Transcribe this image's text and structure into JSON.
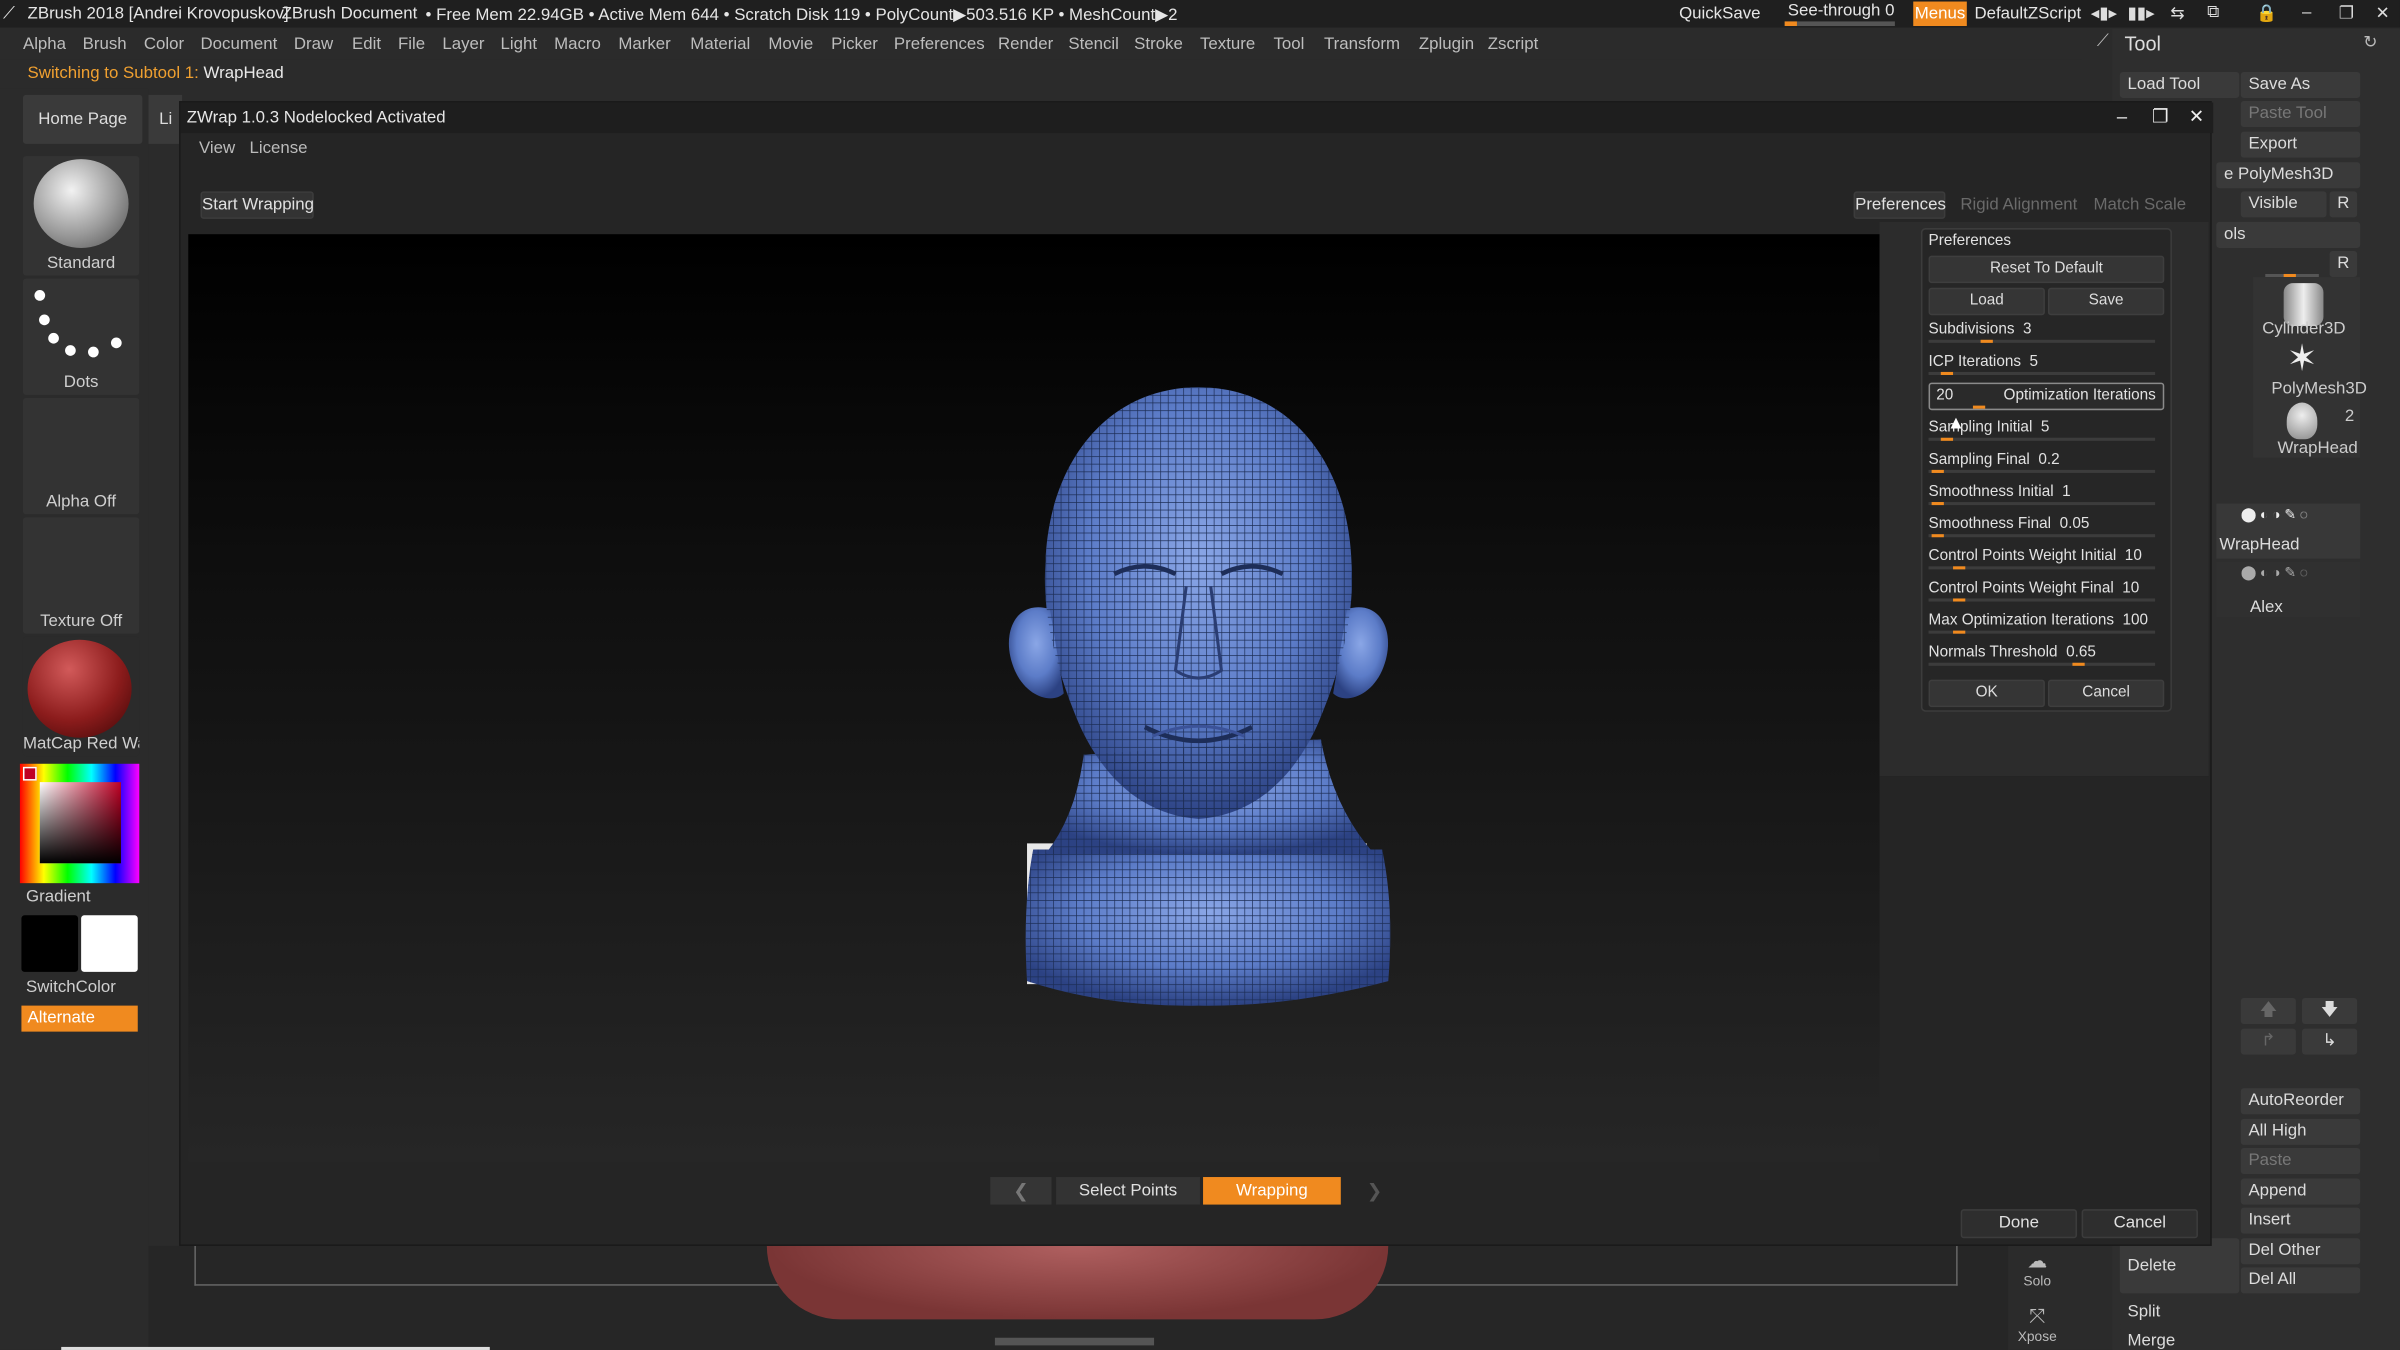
{
  "titlebar": {
    "app": "ZBrush 2018 [Andrei Krovopuskov]",
    "doc": "ZBrush Document",
    "stats": "• Free Mem 22.94GB • Active Mem 644 • Scratch Disk 119 • PolyCount▶503.516 KP • MeshCount▶2",
    "quicksave": "QuickSave",
    "seethrough": "See-through  0",
    "menus": "Menus",
    "script": "DefaultZScript"
  },
  "menubar": [
    "Alpha",
    "Brush",
    "Color",
    "Document",
    "Draw",
    "Edit",
    "File",
    "Layer",
    "Light",
    "Macro",
    "Marker",
    "Material",
    "Movie",
    "Picker",
    "Preferences",
    "Render",
    "Stencil",
    "Stroke",
    "Texture",
    "Tool",
    "Transform",
    "Zplugin",
    "Zscript"
  ],
  "subtool_msg": {
    "prefix": "Switching to Subtool 1:",
    "name": "WrapHead"
  },
  "leftshelf": {
    "home": "Home Page",
    "lightbox_short": "Li",
    "brush": "Standard",
    "stroke": "Dots",
    "alpha": "Alpha Off",
    "texture": "Texture Off",
    "material": "MatCap Red Wax",
    "gradient": "Gradient",
    "switchcolor": "SwitchColor",
    "alternate": "Alternate",
    "accent_color": "#f08a1f"
  },
  "zwrap": {
    "title": "ZWrap 1.0.3  Nodelocked Activated",
    "menu": [
      "View",
      "License"
    ],
    "start": "Start Wrapping",
    "tabs": [
      "Preferences",
      "Rigid Alignment",
      "Match Scale"
    ],
    "steps": {
      "prev": "❮",
      "select": "Select Points",
      "wrapping": "Wrapping",
      "next": "❯"
    },
    "done": "Done",
    "cancel": "Cancel"
  },
  "prefs": {
    "title": "Preferences",
    "reset": "Reset To Default",
    "load": "Load",
    "save": "Save",
    "ok": "OK",
    "cancel": "Cancel",
    "opt_value": "20",
    "opt_label": "Optimization Iterations",
    "sliders": [
      {
        "label": "Subdivisions",
        "value": "3"
      },
      {
        "label": "ICP Iterations",
        "value": "5"
      },
      {
        "label": "Sampling Initial",
        "value": "5"
      },
      {
        "label": "Sampling Final",
        "value": "0.2"
      },
      {
        "label": "Smoothness Initial",
        "value": "1"
      },
      {
        "label": "Smoothness Final",
        "value": "0.05"
      },
      {
        "label": "Control Points Weight Initial",
        "value": "10"
      },
      {
        "label": "Control Points Weight Final",
        "value": "10"
      },
      {
        "label": "Max Optimization Iterations",
        "value": "100"
      },
      {
        "label": "Normals Threshold",
        "value": "0.65"
      }
    ]
  },
  "tool": {
    "title": "Tool",
    "load": "Load Tool",
    "saveas": "Save As",
    "paste": "Paste Tool",
    "export": "Export",
    "polymesh": "e PolyMesh3D",
    "visible": "Visible",
    "r": "R",
    "ols": "ols",
    "thumbs": [
      "Cylinder3D",
      "PolyMesh3D",
      "WrapHead"
    ],
    "thumb_count": "2",
    "subtool_name": "WrapHead",
    "subtool2": "Alex",
    "bottom": [
      "AutoReorder",
      "All High",
      "Paste",
      "Append",
      "Insert",
      "Del Other",
      "Del All"
    ],
    "delete": "Delete",
    "split": "Split",
    "merge": "Merge",
    "solo": "Solo",
    "xpose": "Xpose"
  }
}
